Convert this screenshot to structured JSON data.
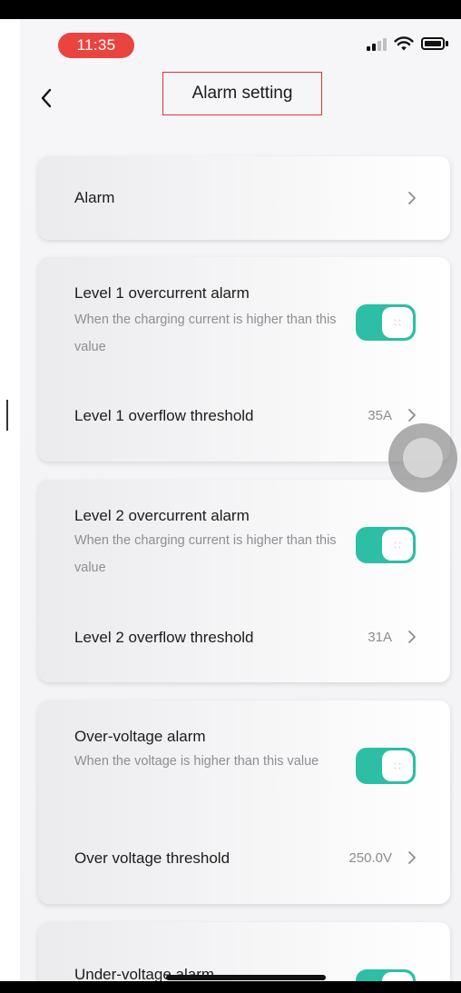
{
  "status_bar": {
    "time": "11:35"
  },
  "header": {
    "title": "Alarm setting"
  },
  "alarm_row": {
    "label": "Alarm"
  },
  "level1": {
    "label": "Level 1 overcurrent alarm",
    "description": "When the charging current is higher than this value",
    "enabled": true,
    "threshold_label": "Level 1 overflow threshold",
    "threshold_value": "35A"
  },
  "level2": {
    "label": "Level 2 overcurrent alarm",
    "description": "When the charging current is higher than this value",
    "enabled": true,
    "threshold_label": "Level 2 overflow threshold",
    "threshold_value": "31A"
  },
  "over_voltage": {
    "label": "Over-voltage alarm",
    "description": "When the voltage is higher than this value",
    "enabled": true,
    "threshold_label": "Over voltage threshold",
    "threshold_value": "250.0V"
  },
  "under_voltage": {
    "label": "Under-voltage alarm",
    "enabled": true
  },
  "colors": {
    "toggle_on": "#2dbfa5",
    "time_pill": "#e94440",
    "title_highlight": "#e23232"
  }
}
